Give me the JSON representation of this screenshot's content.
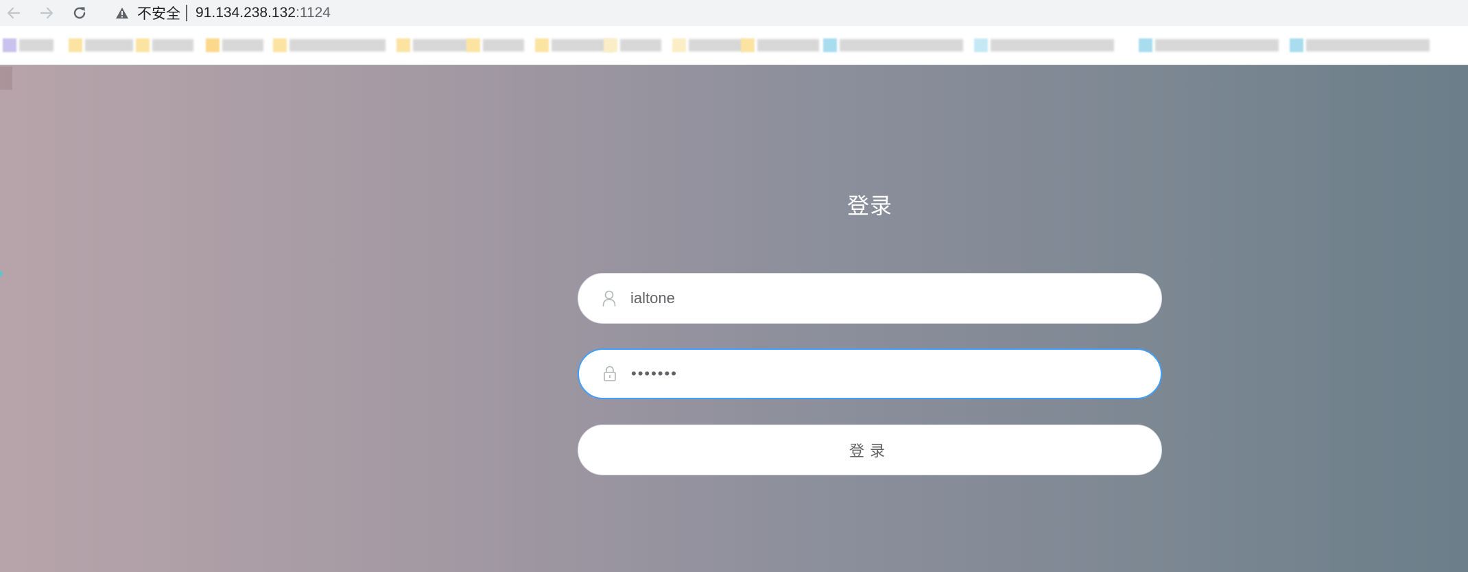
{
  "browser": {
    "security_label": "不安全",
    "url_host": "91.134.238.132",
    "url_port": ":1124",
    "icons": {
      "back": "arrow-left-icon",
      "forward": "arrow-right-icon",
      "reload": "reload-icon",
      "security": "warning-triangle-icon"
    },
    "bookmarks_obscured": true
  },
  "login": {
    "title": "登录",
    "username_value": "ialtone",
    "password_value": "1234567",
    "button_label": "登录",
    "icons": {
      "username": "user-icon",
      "password": "lock-icon"
    },
    "focus_color": "#409eff"
  },
  "page": {
    "background_gradient": [
      "#b7a4aa",
      "#a399a3",
      "#8d8f9c",
      "#7d8893",
      "#6b7e89"
    ]
  }
}
